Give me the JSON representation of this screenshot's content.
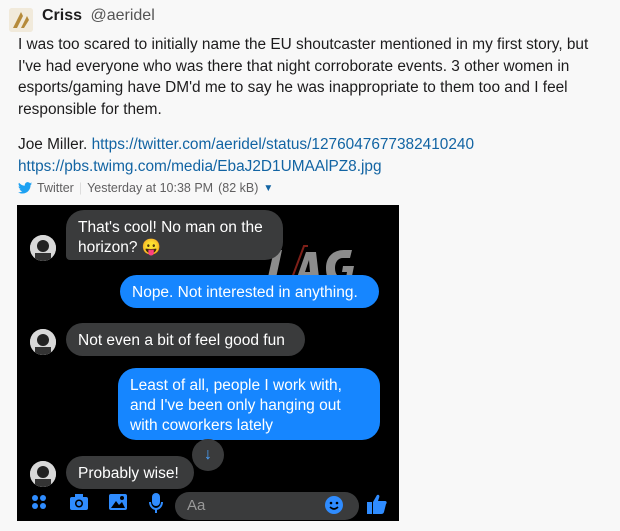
{
  "post": {
    "author": "Criss",
    "handle": "@aeridel",
    "body": "I was too scared to initially name the EU shoutcaster mentioned in my first story, but I've had everyone who was there that night corroborate events. 3 other women in esports/gaming have DM'd me to say he was inappropriate to them too and I feel responsible for them.",
    "links_prefix": "Joe Miller.",
    "link1": "https://twitter.com/aeridel/status/1276047677382410240",
    "link2": "https://pbs.twimg.com/media/EbaJ2D1UMAAlPZ8.jpg",
    "unfurl": {
      "source": "Twitter",
      "time": "Yesterday at 10:38 PM",
      "size": "(82 kB)"
    }
  },
  "chat": {
    "messages": [
      {
        "from": "other",
        "text_line1": "That's cool! No man on the",
        "text_line2": "horizon? 😛"
      },
      {
        "from": "me",
        "text": "Nope. Not interested in anything."
      },
      {
        "from": "other",
        "text": "Not even a bit of feel good fun"
      },
      {
        "from": "me",
        "text_line1": "Least of all, people I work with,",
        "text_line2": "and I've been only hanging out",
        "text_line3": "with coworkers lately"
      },
      {
        "from": "other",
        "text": "Probably wise!"
      }
    ],
    "watermark": "LAG.VN",
    "composer_placeholder": "Aa",
    "icons": [
      "apps-icon",
      "camera-icon",
      "image-icon",
      "mic-icon",
      "emoji-icon",
      "thumbs-up-icon"
    ],
    "accent_color": "#1686ff"
  }
}
